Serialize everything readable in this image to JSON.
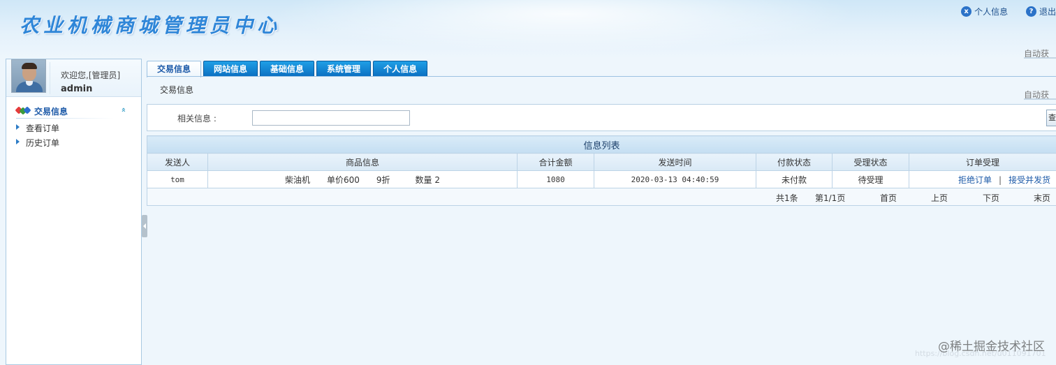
{
  "header": {
    "title": "农业机械商城管理员中心",
    "links": [
      {
        "label": "个人信息",
        "icon": "user-info-icon",
        "glyph": "x"
      },
      {
        "label": "退出",
        "icon": "help-exit-icon",
        "glyph": "?"
      }
    ],
    "auto_refresh_label": "自动获"
  },
  "sidebar": {
    "welcome": "欢迎您,[管理员]",
    "username": "admin",
    "menu_title": "交易信息",
    "collapse_glyph": "»",
    "items": [
      {
        "label": "查看订单"
      },
      {
        "label": "历史订单"
      }
    ]
  },
  "tabs": [
    {
      "label": "交易信息",
      "active": true
    },
    {
      "label": "网站信息",
      "active": false
    },
    {
      "label": "基础信息",
      "active": false
    },
    {
      "label": "系统管理",
      "active": false
    },
    {
      "label": "个人信息",
      "active": false
    }
  ],
  "breadcrumb": "交易信息",
  "search": {
    "label": "相关信息 :",
    "value": "",
    "button_label": "查"
  },
  "table": {
    "caption": "信息列表",
    "columns": [
      "发送人",
      "商品信息",
      "合计金额",
      "发送时间",
      "付款状态",
      "受理状态",
      "订单受理"
    ],
    "rows": [
      {
        "sender": "tom",
        "goods_name": "柴油机",
        "goods_price": "单价600",
        "goods_discount": "9折",
        "goods_qty": "数量 2",
        "total": "1080",
        "time": "2020-03-13 04:40:59",
        "pay_status": "未付款",
        "accept_status": "待受理",
        "reject_label": "拒绝订单",
        "separator": "|",
        "accept_label": "接受并发货"
      }
    ]
  },
  "pager": {
    "total": "共1条",
    "page": "第1/1页",
    "first": "首页",
    "prev": "上页",
    "next": "下页",
    "last": "末页"
  },
  "watermark": {
    "text": "@稀土掘金技术社区",
    "url": "https://blog.csdn.net/u011091701"
  },
  "colors": {
    "tab_blue": "#0b6fc1",
    "link_blue": "#1d5aa8",
    "border": "#bcd3e6",
    "title_blue": "#2f86d8"
  }
}
